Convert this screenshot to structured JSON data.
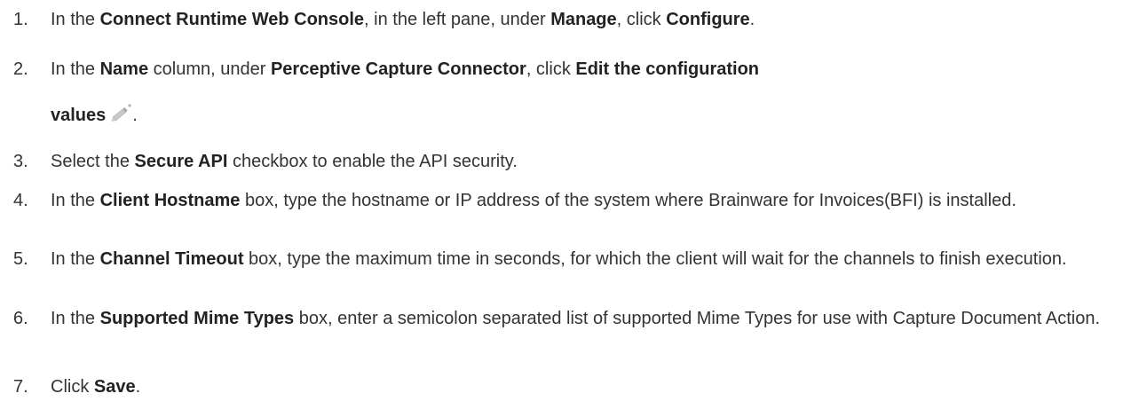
{
  "steps": [
    {
      "number": "1.",
      "parts": [
        {
          "t": "In the ",
          "b": false
        },
        {
          "t": "Connect Runtime Web Console",
          "b": true
        },
        {
          "t": ", in the left pane, under ",
          "b": false
        },
        {
          "t": "Manage",
          "b": true
        },
        {
          "t": ", click ",
          "b": false
        },
        {
          "t": "Configure",
          "b": true
        },
        {
          "t": ".",
          "b": false
        }
      ]
    },
    {
      "number": "2.",
      "parts": [
        {
          "t": "In the ",
          "b": false
        },
        {
          "t": "Name",
          "b": true
        },
        {
          "t": " column, under ",
          "b": false
        },
        {
          "t": "Perceptive Capture Connector",
          "b": true
        },
        {
          "t": ", click ",
          "b": false
        },
        {
          "t": "Edit the configuration",
          "b": true
        }
      ],
      "continuation": [
        {
          "t": "values",
          "b": true
        }
      ],
      "icon": "pencil-icon",
      "after_icon": "."
    },
    {
      "number": "3.",
      "parts": [
        {
          "t": "Select the ",
          "b": false
        },
        {
          "t": "Secure API",
          "b": true
        },
        {
          "t": " checkbox to enable the API security.",
          "b": false
        }
      ]
    },
    {
      "number": "4.",
      "parts": [
        {
          "t": "In the ",
          "b": false
        },
        {
          "t": "Client Hostname",
          "b": true
        },
        {
          "t": " box, type the hostname or IP address of the system where Brainware for Invoices(BFI) is installed.",
          "b": false
        }
      ]
    },
    {
      "number": "5.",
      "parts": [
        {
          "t": "In the ",
          "b": false
        },
        {
          "t": "Channel Timeout",
          "b": true
        },
        {
          "t": " box, type the maximum time in seconds, for which the client will wait for the channels to finish execution.",
          "b": false
        }
      ]
    },
    {
      "number": "6.",
      "parts": [
        {
          "t": "In the ",
          "b": false
        },
        {
          "t": "Supported Mime Types",
          "b": true
        },
        {
          "t": " box, enter a semicolon separated list of supported Mime Types for use with Capture Document Action.",
          "b": false
        }
      ]
    },
    {
      "number": "7.",
      "parts": [
        {
          "t": "Click ",
          "b": false
        },
        {
          "t": "Save",
          "b": true
        },
        {
          "t": ".",
          "b": false
        }
      ]
    }
  ]
}
